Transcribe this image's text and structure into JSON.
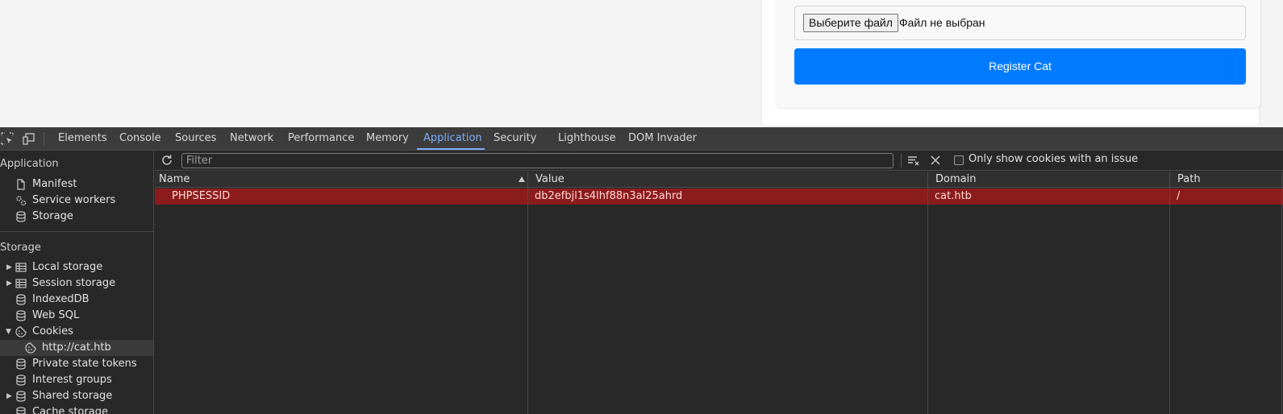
{
  "page": {
    "file_button_label": "Выберите файл",
    "file_status": "Файл не выбран",
    "submit_label": "Register Cat"
  },
  "devtools": {
    "tabs": [
      {
        "label": "Elements"
      },
      {
        "label": "Console"
      },
      {
        "label": "Sources"
      },
      {
        "label": "Network"
      },
      {
        "label": "Performance"
      },
      {
        "label": "Memory"
      },
      {
        "label": "Application",
        "active": true
      },
      {
        "label": "Security"
      },
      {
        "label": "Lighthouse"
      },
      {
        "label": "DOM Invader"
      }
    ],
    "accent_color": "#7cacf8",
    "sidebar": {
      "application_header": "Application",
      "application_items": [
        {
          "label": "Manifest",
          "icon": "document-icon"
        },
        {
          "label": "Service workers",
          "icon": "gears-icon"
        },
        {
          "label": "Storage",
          "icon": "database-icon"
        }
      ],
      "storage_header": "Storage",
      "storage_items": [
        {
          "label": "Local storage",
          "icon": "table-icon",
          "expandable": true
        },
        {
          "label": "Session storage",
          "icon": "table-icon",
          "expandable": true
        },
        {
          "label": "IndexedDB",
          "icon": "database-icon"
        },
        {
          "label": "Web SQL",
          "icon": "database-icon"
        },
        {
          "label": "Cookies",
          "icon": "cookie-icon",
          "expanded": true
        },
        {
          "label": "http://cat.htb",
          "icon": "cookie-icon",
          "selected": true,
          "child": true
        },
        {
          "label": "Private state tokens",
          "icon": "database-icon"
        },
        {
          "label": "Interest groups",
          "icon": "database-icon"
        },
        {
          "label": "Shared storage",
          "icon": "database-icon",
          "expandable": true
        },
        {
          "label": "Cache storage",
          "icon": "database-icon"
        }
      ]
    },
    "cookies": {
      "filter_placeholder": "Filter",
      "only_issues_label": "Only show cookies with an issue",
      "columns": [
        "Name",
        "Value",
        "Domain",
        "Path"
      ],
      "rows": [
        {
          "name": "PHPSESSID",
          "value": "db2efbjl1s4lhf88n3al25ahrd",
          "domain": "cat.htb",
          "path": "/"
        }
      ],
      "issue_row_color": "#8c1c1c"
    }
  }
}
